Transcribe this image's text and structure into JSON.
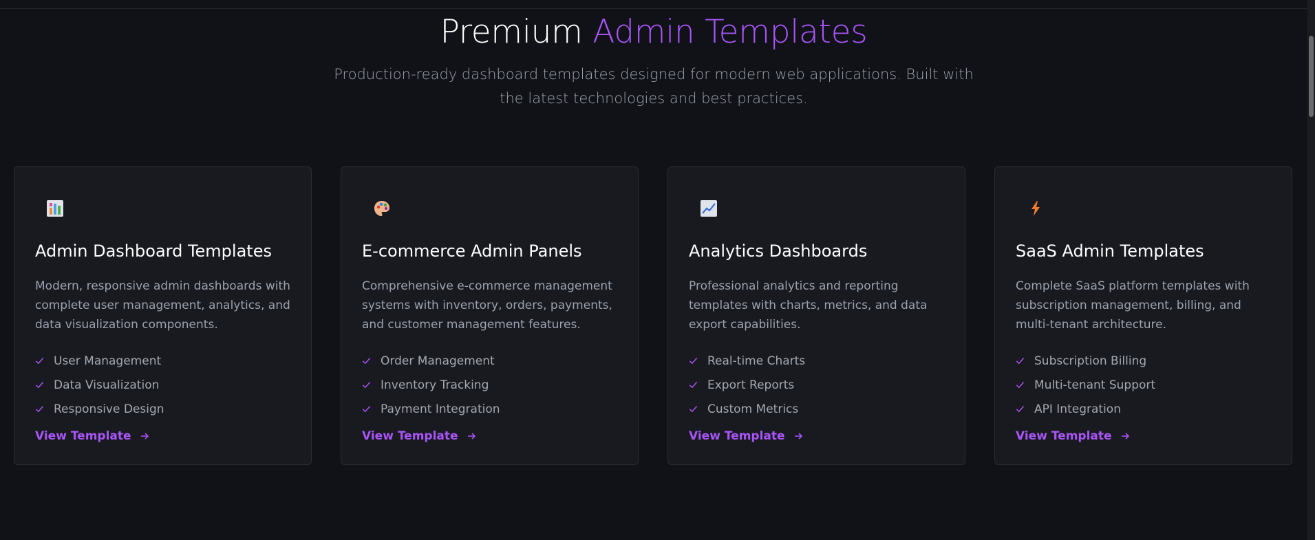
{
  "hero": {
    "title_plain": "Premium ",
    "title_accent": "Admin Templates",
    "subtitle": "Production-ready dashboard templates designed for modern web applications. Built with the latest technologies and best practices."
  },
  "colors": {
    "accent": "#a855f7",
    "background": "#111217",
    "card": "#181a20"
  },
  "cards": [
    {
      "icon": "bar-chart-icon",
      "title": "Admin Dashboard Templates",
      "description": "Modern, responsive admin dashboards with complete user management, analytics, and data visualization components.",
      "features": [
        "User Management",
        "Data Visualization",
        "Responsive Design"
      ],
      "link_label": "View Template"
    },
    {
      "icon": "palette-icon",
      "title": "E-commerce Admin Panels",
      "description": "Comprehensive e-commerce management systems with inventory, orders, payments, and customer management features.",
      "features": [
        "Order Management",
        "Inventory Tracking",
        "Payment Integration"
      ],
      "link_label": "View Template"
    },
    {
      "icon": "trend-chart-icon",
      "title": "Analytics Dashboards",
      "description": "Professional analytics and reporting templates with charts, metrics, and data export capabilities.",
      "features": [
        "Real-time Charts",
        "Export Reports",
        "Custom Metrics"
      ],
      "link_label": "View Template"
    },
    {
      "icon": "lightning-icon",
      "title": "SaaS Admin Templates",
      "description": "Complete SaaS platform templates with subscription management, billing, and multi-tenant architecture.",
      "features": [
        "Subscription Billing",
        "Multi-tenant Support",
        "API Integration"
      ],
      "link_label": "View Template"
    }
  ]
}
